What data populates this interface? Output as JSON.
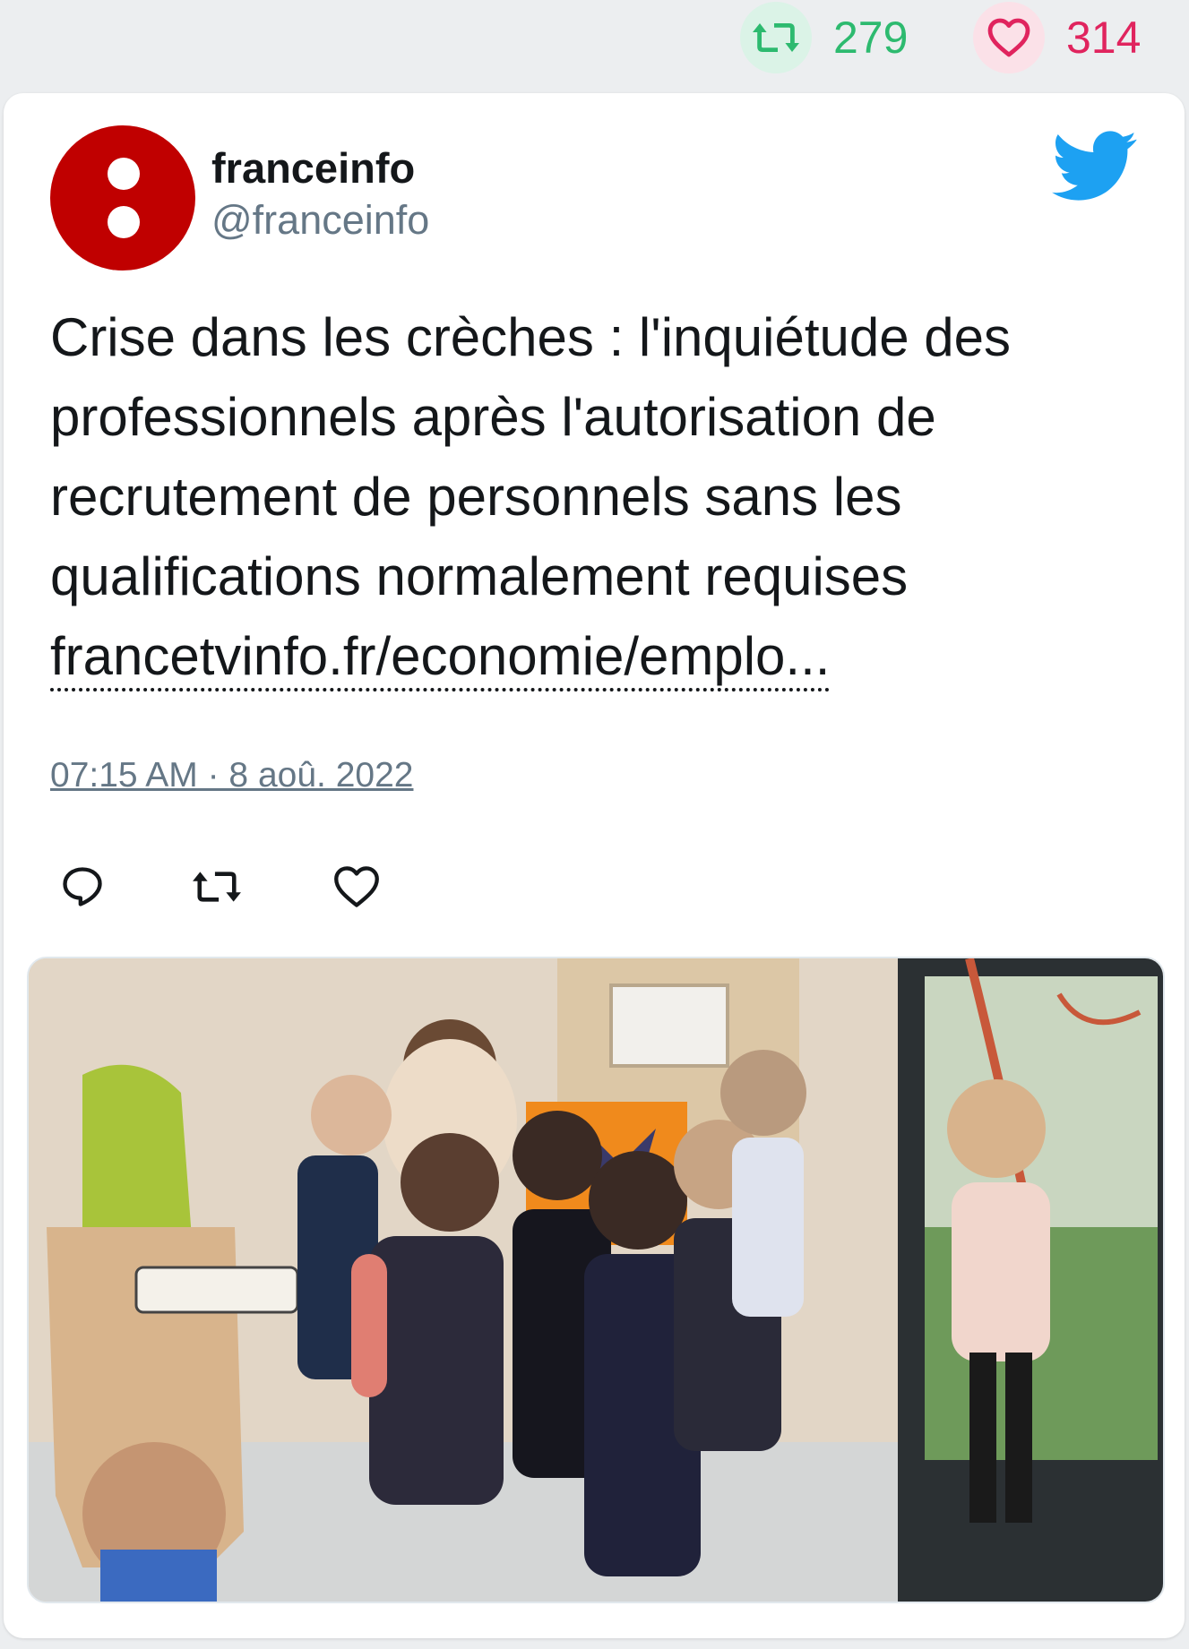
{
  "stats": {
    "retweets": "279",
    "likes": "314",
    "retweet_icon": "retweet-icon",
    "like_icon": "heart-icon"
  },
  "tweet": {
    "author": {
      "display_name": "franceinfo",
      "handle": "@franceinfo",
      "avatar_color": "#c00000"
    },
    "text": "Crise dans les crèches : l'inquiétude des professionnels après l'autorisation de recrutement de personnels sans les qualifications normalement requises",
    "link_text": "francetvinfo.fr/economie/emplo...",
    "timestamp": "07:15 AM · 8 aoû. 2022",
    "actions": [
      "reply-icon",
      "retweet-icon",
      "heart-icon"
    ],
    "media": {
      "alt": "photo"
    }
  },
  "colors": {
    "retweet_green": "#2dba6f",
    "like_red": "#e0245e",
    "twitter_blue": "#1da1f2",
    "muted_text": "#657786",
    "background": "#eceef0"
  }
}
